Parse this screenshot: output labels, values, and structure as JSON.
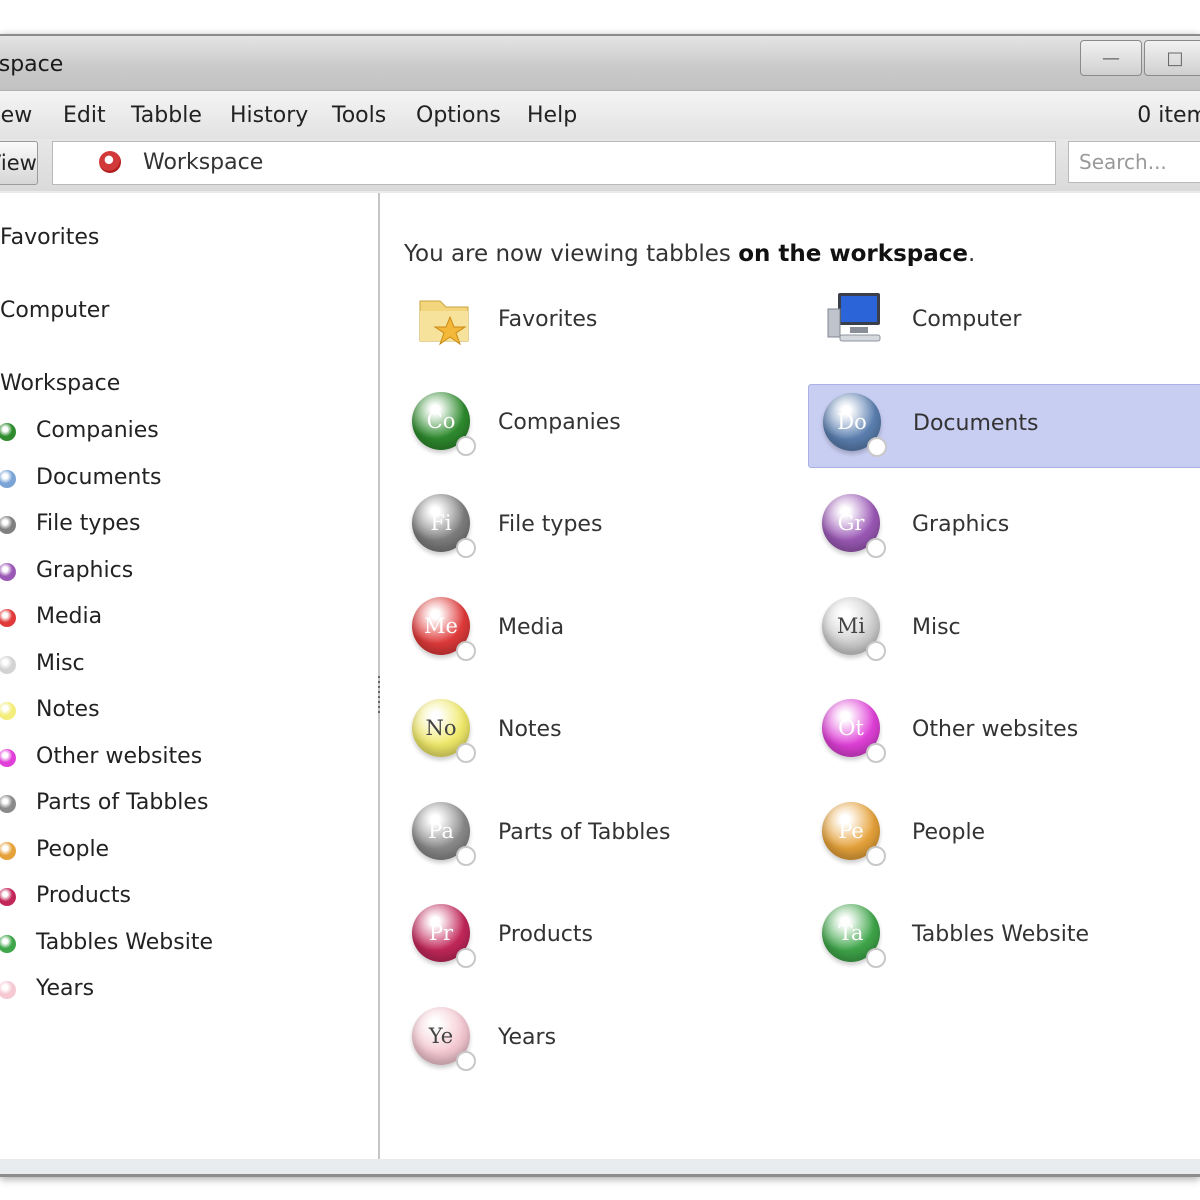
{
  "window": {
    "title": "kspace"
  },
  "menu": [
    "View",
    "Edit",
    "Tabble",
    "History",
    "Tools",
    "Options",
    "Help"
  ],
  "status": {
    "items": "0 item"
  },
  "toolbar": {
    "view_button": "View",
    "address": "Workspace",
    "search_placeholder": "Search..."
  },
  "sidebar": {
    "favorites": "Favorites",
    "computer": "Computer",
    "workspace": "Workspace",
    "items": [
      {
        "label": "Companies",
        "color": "#2e8b2e"
      },
      {
        "label": "Documents",
        "color": "#7aa4d6"
      },
      {
        "label": "File types",
        "color": "#808080"
      },
      {
        "label": "Graphics",
        "color": "#9b59b6"
      },
      {
        "label": "Media",
        "color": "#e03a3a"
      },
      {
        "label": "Misc",
        "color": "#d3d3d3"
      },
      {
        "label": "Notes",
        "color": "#f3ee7a"
      },
      {
        "label": "Other websites",
        "color": "#e040d8"
      },
      {
        "label": "Parts of Tabbles",
        "color": "#8a8a8a"
      },
      {
        "label": "People",
        "color": "#e6a23a"
      },
      {
        "label": "Products",
        "color": "#c2275a"
      },
      {
        "label": "Tabbles Website",
        "color": "#3fa64a"
      },
      {
        "label": "Years",
        "color": "#f5c8d2"
      }
    ]
  },
  "main": {
    "heading_prefix": "You are now viewing tabbles ",
    "heading_bold": "on the workspace",
    "heading_suffix": ".",
    "tiles": [
      {
        "label": "Favorites",
        "abbr": "",
        "color": "",
        "icon": "favorites-folder-icon"
      },
      {
        "label": "Computer",
        "abbr": "",
        "color": "",
        "icon": "computer-icon"
      },
      {
        "label": "Companies",
        "abbr": "Co",
        "color": "#2e8b2e"
      },
      {
        "label": "Documents",
        "abbr": "Do",
        "color": "#5b7fb0",
        "selected": true
      },
      {
        "label": "File types",
        "abbr": "Fi",
        "color": "#7d7d7d"
      },
      {
        "label": "Graphics",
        "abbr": "Gr",
        "color": "#9b59b6"
      },
      {
        "label": "Media",
        "abbr": "Me",
        "color": "#e03a3a"
      },
      {
        "label": "Misc",
        "abbr": "Mi",
        "color": "#cfcfcf"
      },
      {
        "label": "Notes",
        "abbr": "No",
        "color": "#f0e96a"
      },
      {
        "label": "Other websites",
        "abbr": "Ot",
        "color": "#e040d8"
      },
      {
        "label": "Parts of Tabbles",
        "abbr": "Pa",
        "color": "#8a8a8a"
      },
      {
        "label": "People",
        "abbr": "Pe",
        "color": "#e6a23a"
      },
      {
        "label": "Products",
        "abbr": "Pr",
        "color": "#c2275a"
      },
      {
        "label": "Tabbles Website",
        "abbr": "Ta",
        "color": "#3fa64a"
      },
      {
        "label": "Years",
        "abbr": "Ye",
        "color": "#f5c8d2"
      }
    ]
  }
}
